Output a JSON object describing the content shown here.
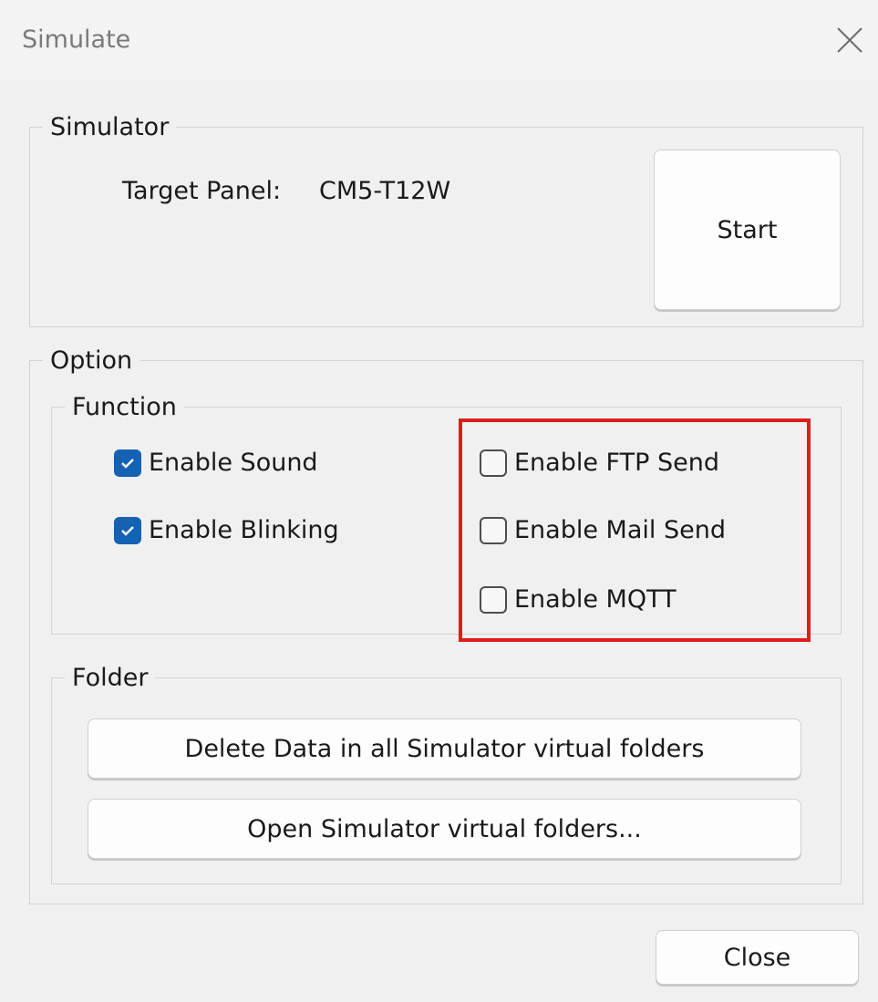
{
  "window": {
    "title": "Simulate",
    "close_icon": "close-x-icon"
  },
  "simulator": {
    "legend": "Simulator",
    "target_panel_label": "Target Panel:",
    "target_panel_value": "CM5-T12W",
    "start_button": "Start"
  },
  "option": {
    "legend": "Option",
    "function": {
      "legend": "Function",
      "checkboxes": [
        {
          "label": "Enable Sound",
          "checked": true
        },
        {
          "label": "Enable Blinking",
          "checked": true
        },
        {
          "label": "Enable FTP Send",
          "checked": false
        },
        {
          "label": "Enable Mail Send",
          "checked": false
        },
        {
          "label": "Enable MQTT",
          "checked": false
        }
      ]
    },
    "folder": {
      "legend": "Folder",
      "delete_button": "Delete Data in all Simulator virtual folders",
      "open_button": "Open Simulator virtual folders..."
    }
  },
  "footer": {
    "close_button": "Close"
  },
  "colors": {
    "accent": "#1462b4",
    "highlight": "#e01b1b"
  }
}
